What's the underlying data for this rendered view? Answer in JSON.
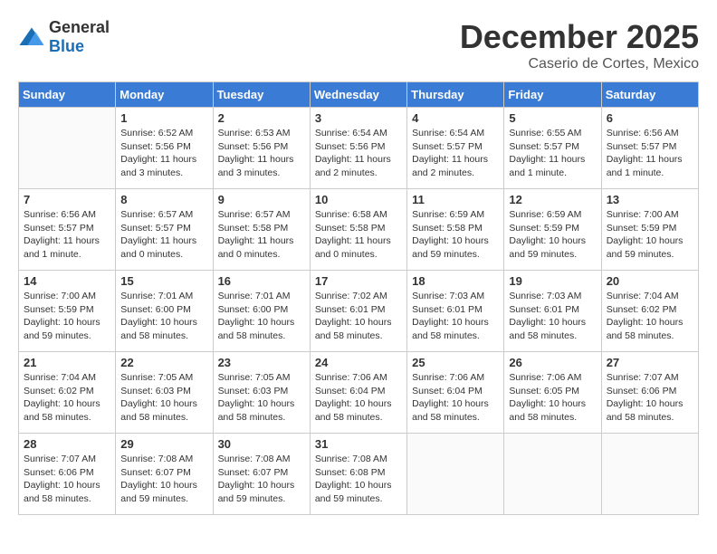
{
  "header": {
    "logo_general": "General",
    "logo_blue": "Blue",
    "title": "December 2025",
    "location": "Caserio de Cortes, Mexico"
  },
  "calendar": {
    "weekdays": [
      "Sunday",
      "Monday",
      "Tuesday",
      "Wednesday",
      "Thursday",
      "Friday",
      "Saturday"
    ],
    "weeks": [
      [
        {
          "day": "",
          "sunrise": "",
          "sunset": "",
          "daylight": ""
        },
        {
          "day": "1",
          "sunrise": "Sunrise: 6:52 AM",
          "sunset": "Sunset: 5:56 PM",
          "daylight": "Daylight: 11 hours and 3 minutes."
        },
        {
          "day": "2",
          "sunrise": "Sunrise: 6:53 AM",
          "sunset": "Sunset: 5:56 PM",
          "daylight": "Daylight: 11 hours and 3 minutes."
        },
        {
          "day": "3",
          "sunrise": "Sunrise: 6:54 AM",
          "sunset": "Sunset: 5:56 PM",
          "daylight": "Daylight: 11 hours and 2 minutes."
        },
        {
          "day": "4",
          "sunrise": "Sunrise: 6:54 AM",
          "sunset": "Sunset: 5:57 PM",
          "daylight": "Daylight: 11 hours and 2 minutes."
        },
        {
          "day": "5",
          "sunrise": "Sunrise: 6:55 AM",
          "sunset": "Sunset: 5:57 PM",
          "daylight": "Daylight: 11 hours and 1 minute."
        },
        {
          "day": "6",
          "sunrise": "Sunrise: 6:56 AM",
          "sunset": "Sunset: 5:57 PM",
          "daylight": "Daylight: 11 hours and 1 minute."
        }
      ],
      [
        {
          "day": "7",
          "sunrise": "Sunrise: 6:56 AM",
          "sunset": "Sunset: 5:57 PM",
          "daylight": "Daylight: 11 hours and 1 minute."
        },
        {
          "day": "8",
          "sunrise": "Sunrise: 6:57 AM",
          "sunset": "Sunset: 5:57 PM",
          "daylight": "Daylight: 11 hours and 0 minutes."
        },
        {
          "day": "9",
          "sunrise": "Sunrise: 6:57 AM",
          "sunset": "Sunset: 5:58 PM",
          "daylight": "Daylight: 11 hours and 0 minutes."
        },
        {
          "day": "10",
          "sunrise": "Sunrise: 6:58 AM",
          "sunset": "Sunset: 5:58 PM",
          "daylight": "Daylight: 11 hours and 0 minutes."
        },
        {
          "day": "11",
          "sunrise": "Sunrise: 6:59 AM",
          "sunset": "Sunset: 5:58 PM",
          "daylight": "Daylight: 10 hours and 59 minutes."
        },
        {
          "day": "12",
          "sunrise": "Sunrise: 6:59 AM",
          "sunset": "Sunset: 5:59 PM",
          "daylight": "Daylight: 10 hours and 59 minutes."
        },
        {
          "day": "13",
          "sunrise": "Sunrise: 7:00 AM",
          "sunset": "Sunset: 5:59 PM",
          "daylight": "Daylight: 10 hours and 59 minutes."
        }
      ],
      [
        {
          "day": "14",
          "sunrise": "Sunrise: 7:00 AM",
          "sunset": "Sunset: 5:59 PM",
          "daylight": "Daylight: 10 hours and 59 minutes."
        },
        {
          "day": "15",
          "sunrise": "Sunrise: 7:01 AM",
          "sunset": "Sunset: 6:00 PM",
          "daylight": "Daylight: 10 hours and 58 minutes."
        },
        {
          "day": "16",
          "sunrise": "Sunrise: 7:01 AM",
          "sunset": "Sunset: 6:00 PM",
          "daylight": "Daylight: 10 hours and 58 minutes."
        },
        {
          "day": "17",
          "sunrise": "Sunrise: 7:02 AM",
          "sunset": "Sunset: 6:01 PM",
          "daylight": "Daylight: 10 hours and 58 minutes."
        },
        {
          "day": "18",
          "sunrise": "Sunrise: 7:03 AM",
          "sunset": "Sunset: 6:01 PM",
          "daylight": "Daylight: 10 hours and 58 minutes."
        },
        {
          "day": "19",
          "sunrise": "Sunrise: 7:03 AM",
          "sunset": "Sunset: 6:01 PM",
          "daylight": "Daylight: 10 hours and 58 minutes."
        },
        {
          "day": "20",
          "sunrise": "Sunrise: 7:04 AM",
          "sunset": "Sunset: 6:02 PM",
          "daylight": "Daylight: 10 hours and 58 minutes."
        }
      ],
      [
        {
          "day": "21",
          "sunrise": "Sunrise: 7:04 AM",
          "sunset": "Sunset: 6:02 PM",
          "daylight": "Daylight: 10 hours and 58 minutes."
        },
        {
          "day": "22",
          "sunrise": "Sunrise: 7:05 AM",
          "sunset": "Sunset: 6:03 PM",
          "daylight": "Daylight: 10 hours and 58 minutes."
        },
        {
          "day": "23",
          "sunrise": "Sunrise: 7:05 AM",
          "sunset": "Sunset: 6:03 PM",
          "daylight": "Daylight: 10 hours and 58 minutes."
        },
        {
          "day": "24",
          "sunrise": "Sunrise: 7:06 AM",
          "sunset": "Sunset: 6:04 PM",
          "daylight": "Daylight: 10 hours and 58 minutes."
        },
        {
          "day": "25",
          "sunrise": "Sunrise: 7:06 AM",
          "sunset": "Sunset: 6:04 PM",
          "daylight": "Daylight: 10 hours and 58 minutes."
        },
        {
          "day": "26",
          "sunrise": "Sunrise: 7:06 AM",
          "sunset": "Sunset: 6:05 PM",
          "daylight": "Daylight: 10 hours and 58 minutes."
        },
        {
          "day": "27",
          "sunrise": "Sunrise: 7:07 AM",
          "sunset": "Sunset: 6:06 PM",
          "daylight": "Daylight: 10 hours and 58 minutes."
        }
      ],
      [
        {
          "day": "28",
          "sunrise": "Sunrise: 7:07 AM",
          "sunset": "Sunset: 6:06 PM",
          "daylight": "Daylight: 10 hours and 58 minutes."
        },
        {
          "day": "29",
          "sunrise": "Sunrise: 7:08 AM",
          "sunset": "Sunset: 6:07 PM",
          "daylight": "Daylight: 10 hours and 59 minutes."
        },
        {
          "day": "30",
          "sunrise": "Sunrise: 7:08 AM",
          "sunset": "Sunset: 6:07 PM",
          "daylight": "Daylight: 10 hours and 59 minutes."
        },
        {
          "day": "31",
          "sunrise": "Sunrise: 7:08 AM",
          "sunset": "Sunset: 6:08 PM",
          "daylight": "Daylight: 10 hours and 59 minutes."
        },
        {
          "day": "",
          "sunrise": "",
          "sunset": "",
          "daylight": ""
        },
        {
          "day": "",
          "sunrise": "",
          "sunset": "",
          "daylight": ""
        },
        {
          "day": "",
          "sunrise": "",
          "sunset": "",
          "daylight": ""
        }
      ]
    ]
  }
}
